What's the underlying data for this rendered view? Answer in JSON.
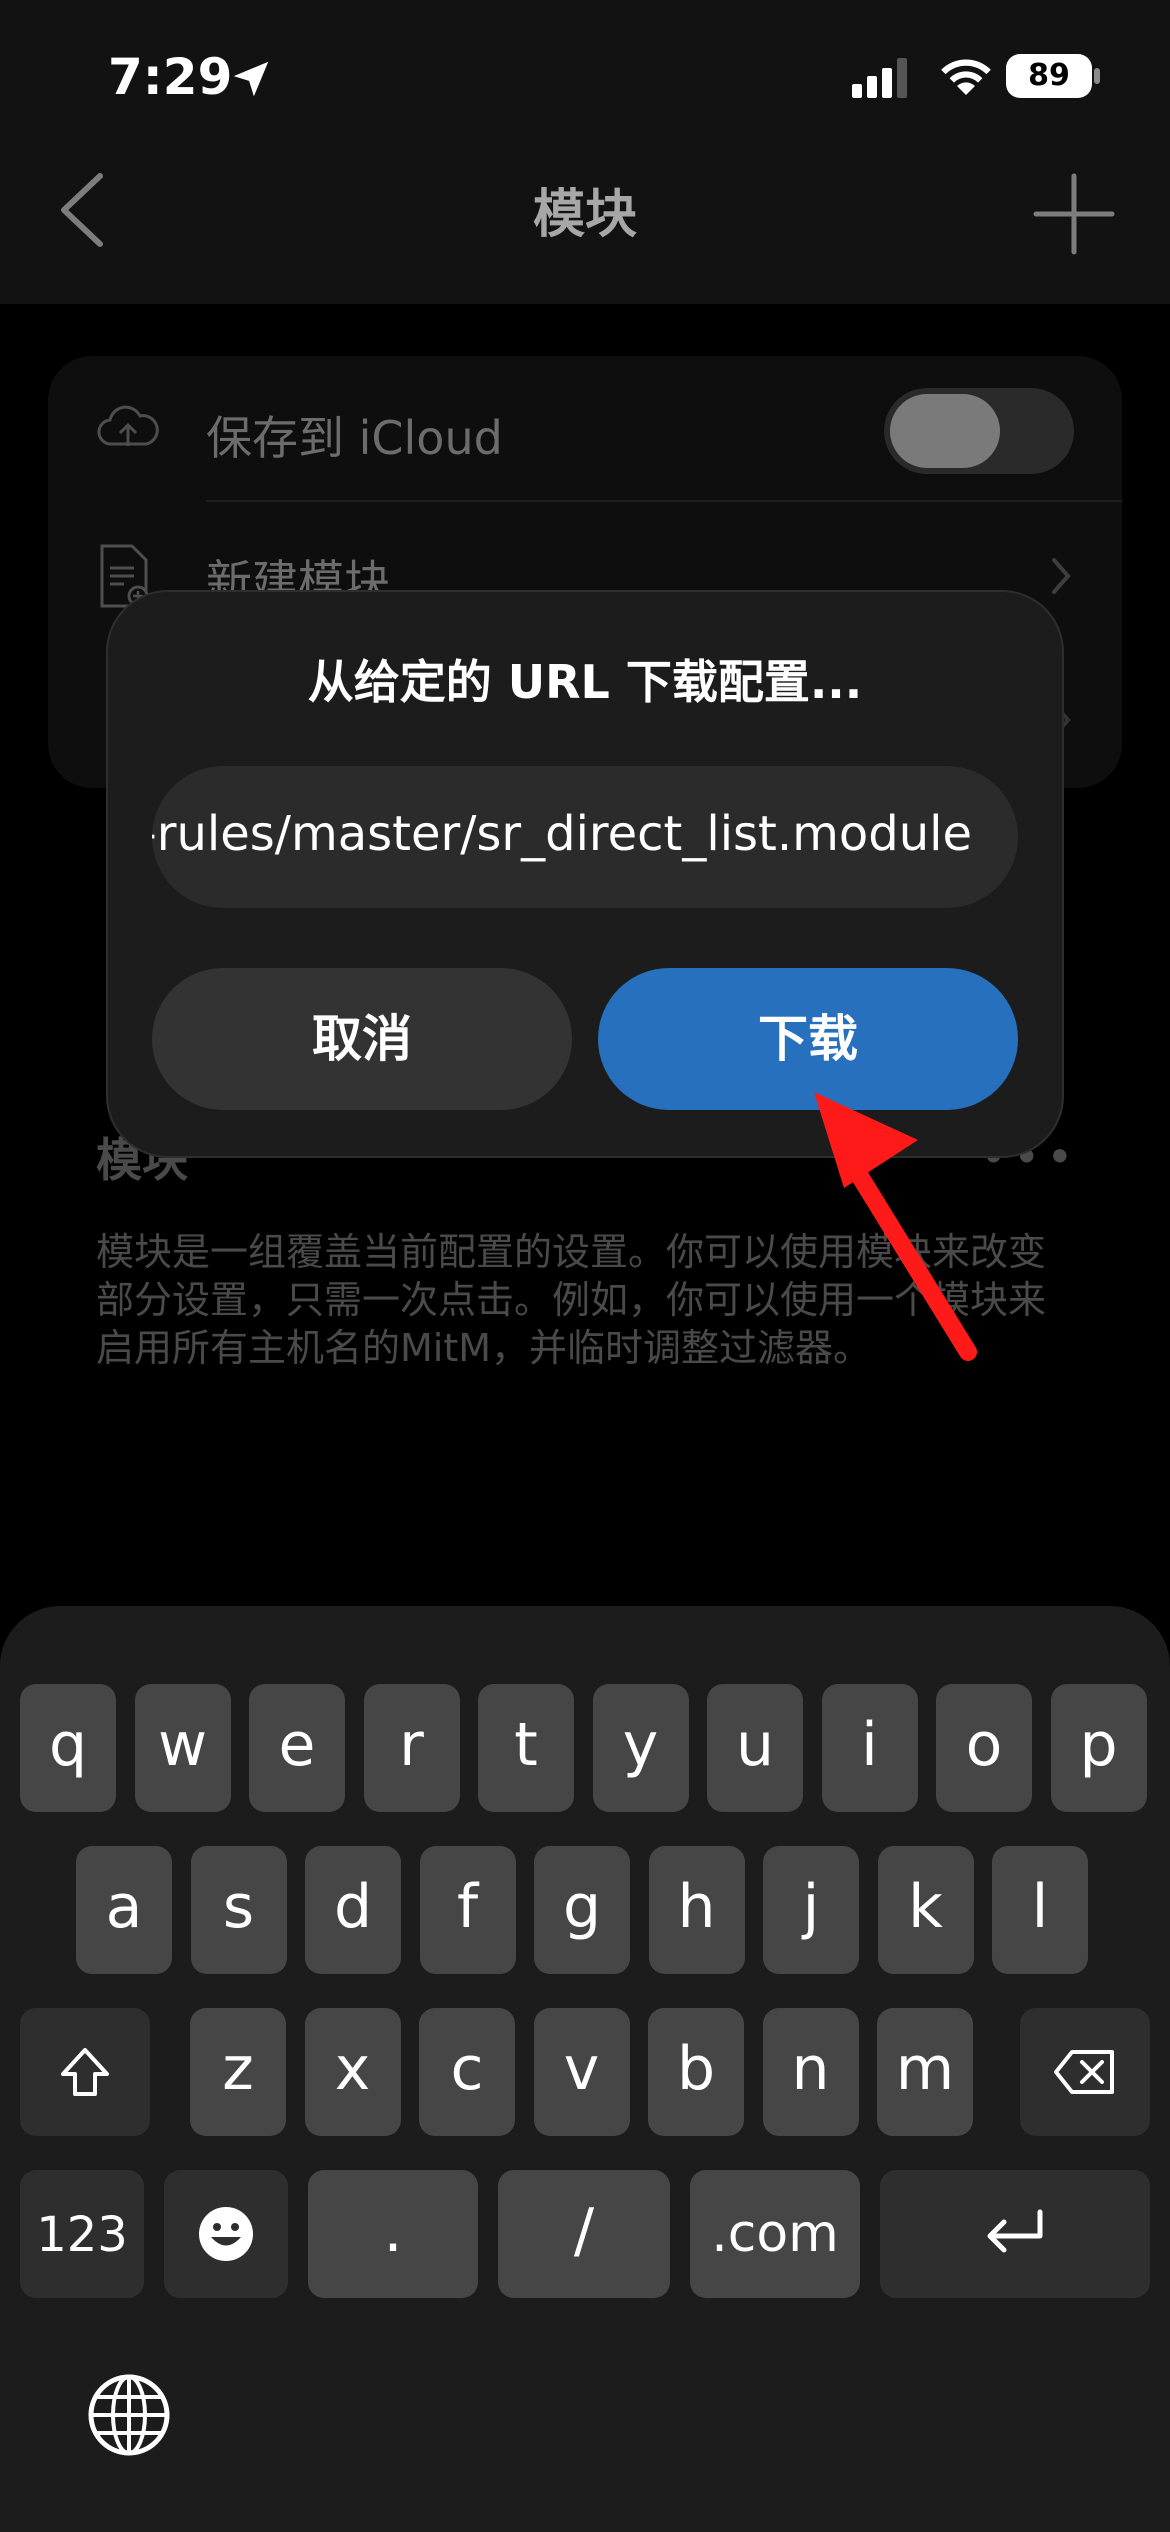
{
  "status_bar": {
    "time": "7:29",
    "battery": "89",
    "location_icon": "location-arrow-icon",
    "signal_icon": "cellular-signal-icon",
    "wifi_icon": "wifi-icon"
  },
  "nav": {
    "title": "模块",
    "back_icon": "chevron-left-icon",
    "add_icon": "plus-icon"
  },
  "settings": {
    "icloud_label": "保存到 iCloud",
    "icloud_toggle_on": false,
    "new_module_label": "新建模块"
  },
  "modules": {
    "header": "模块",
    "more": "•••",
    "description": "模块是一组覆盖当前配置的设置。你可以使用模块来改变部分设置，只需一次点击。例如，你可以使用一个模块来启用所有主机名的MitM，并临时调整过滤器。"
  },
  "dialog": {
    "title": "从给定的 URL 下载配置...",
    "url_value": "-rules/master/sr_direct_list.module",
    "cancel_label": "取消",
    "download_label": "下载"
  },
  "colors": {
    "accent": "#2670be",
    "arrow": "#ff1a1a"
  },
  "keyboard": {
    "row1": [
      "q",
      "w",
      "e",
      "r",
      "t",
      "y",
      "u",
      "i",
      "o",
      "p"
    ],
    "row2": [
      "a",
      "s",
      "d",
      "f",
      "g",
      "h",
      "j",
      "k",
      "l"
    ],
    "row3": [
      "z",
      "x",
      "c",
      "v",
      "b",
      "n",
      "m"
    ],
    "numbers_label": "123",
    "dot_label": ".",
    "slash_label": "/",
    "dotcom_label": ".com",
    "shift_icon": "shift-icon",
    "delete_icon": "delete-icon",
    "emoji_icon": "emoji-icon",
    "return_icon": "return-icon",
    "globe_icon": "globe-icon"
  }
}
